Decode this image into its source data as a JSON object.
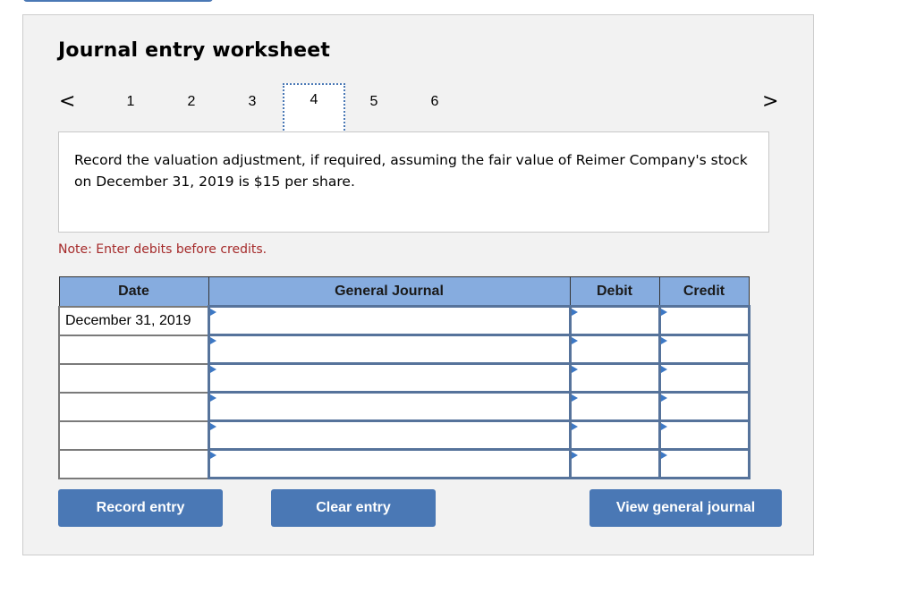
{
  "worksheet": {
    "title": "Journal entry worksheet",
    "nav": {
      "prev_icon": "‹",
      "next_icon": "›",
      "tabs": [
        "1",
        "2",
        "3",
        "4",
        "5",
        "6"
      ],
      "active_tab": "4"
    },
    "question": "Record the valuation adjustment, if required, assuming the fair value of Reimer Company's stock on December 31, 2019 is $15 per share.",
    "note": "Note: Enter debits before credits.",
    "table": {
      "headers": [
        "Date",
        "General Journal",
        "Debit",
        "Credit"
      ],
      "rows": [
        {
          "date": "December 31, 2019",
          "account": "",
          "debit": "",
          "credit": ""
        },
        {
          "date": "",
          "account": "",
          "debit": "",
          "credit": ""
        },
        {
          "date": "",
          "account": "",
          "debit": "",
          "credit": ""
        },
        {
          "date": "",
          "account": "",
          "debit": "",
          "credit": ""
        },
        {
          "date": "",
          "account": "",
          "debit": "",
          "credit": ""
        },
        {
          "date": "",
          "account": "",
          "debit": "",
          "credit": ""
        }
      ]
    },
    "buttons": {
      "record": "Record entry",
      "clear": "Clear entry",
      "view": "View general journal"
    }
  },
  "colors": {
    "accent": "#4a78b5",
    "header_bg": "#86acdf",
    "note_text": "#a52a2a",
    "panel_bg": "#f2f2f2"
  }
}
